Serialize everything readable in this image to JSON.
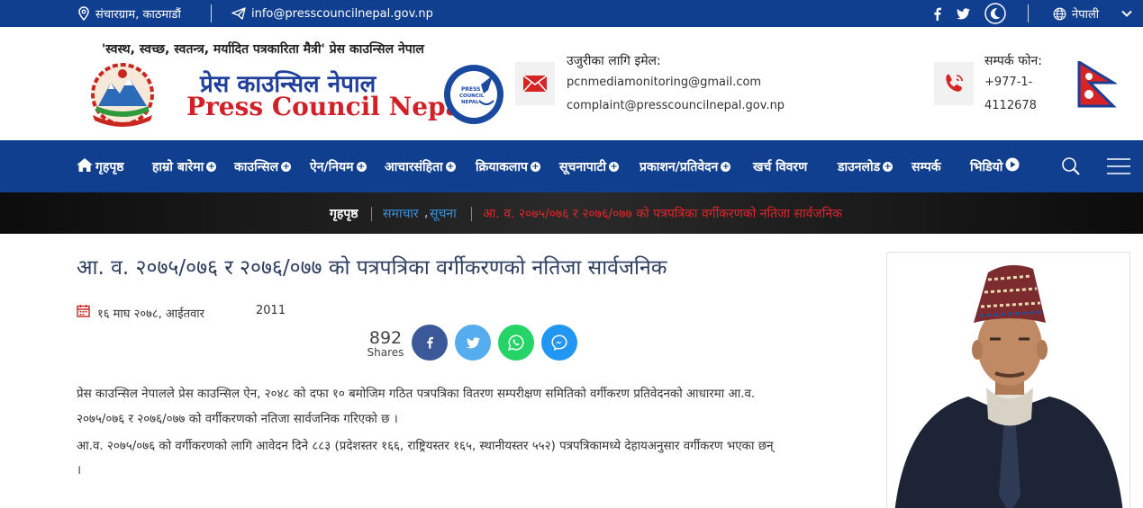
{
  "topbar": {
    "location": "संचारग्राम, काठमाडौं",
    "email": "info@presscouncilnepal.gov.np",
    "language": "नेपाली",
    "icons": [
      "location-icon",
      "send-icon",
      "facebook-icon",
      "twitter-icon",
      "moon-icon",
      "globe-icon",
      "chevron-down-icon"
    ]
  },
  "header": {
    "tagline": "'स्वस्थ, स्वच्छ, स्वतन्त्र, मर्यादित पत्रकारिता मैत्री' प्रेस काउन्सिल नेपाल",
    "logo_nepali": "प्रेस काउन्सिल नेपाल",
    "logo_english": "Press Council Nepal",
    "complaint_title": "उजुरीका लागि इमेल:",
    "complaint_email_1": "pcnmediamonitoring@gmail.com",
    "complaint_email_2": "complaint@presscouncilnepal.gov.np",
    "phone_title": "सम्पर्क फोन:",
    "phone_line_1": "+977-1-",
    "phone_line_2": "4112678"
  },
  "nav": {
    "items": [
      {
        "label": "गृहपृष्ठ"
      },
      {
        "label": "हाम्रो बारेमा"
      },
      {
        "label": "काउन्सिल"
      },
      {
        "label": "ऐन/नियम"
      },
      {
        "label": "आचारसंहिता"
      },
      {
        "label": "क्रियाकलाप"
      },
      {
        "label": "सूचनापाटी"
      },
      {
        "label": "प्रकाशन/प्रतिवेदन"
      },
      {
        "label": "खर्च विवरण"
      },
      {
        "label": "डाउनलोड"
      },
      {
        "label": "सम्पर्क"
      },
      {
        "label": "भिडियो"
      }
    ]
  },
  "breadcrumb": {
    "home": "गृहपृष्ठ",
    "category_1": "समाचार",
    "comma": ",",
    "category_2": "सूचना",
    "current": "आ. व. २०७५/०७६ र २०७६/०७७ को पत्रपत्रिका वर्गीकरणको नतिजा सार्वजनिक"
  },
  "article": {
    "title": "आ. व. २०७५/०७६ र २०७६/०७७ को पत्रपत्रिका वर्गीकरणको नतिजा सार्वजनिक",
    "date": "१६ माघ २०७८, आईतवार",
    "views": "2011",
    "shares_count": "892",
    "shares_label": "Shares",
    "para_1_line_1": "प्रेस काउन्सिल नेपालले प्रेस काउन्सिल ऐन, २०४८ को दफा १० बमोजिम गठित पत्रपत्रिका वितरण सम्परीक्षण समितिको वर्गीकरण प्रतिवेदनको आधारमा आ.व.",
    "para_1_line_2": "२०७५/०७६ र २०७६/०७७ को वर्गीकरणको नतिजा सार्वजनिक गरिएको छ ।",
    "para_2_line_1": "आ.व. २०७५/०७६ को वर्गीकरणको लागि आवेदन दिने ८८३ (प्रदेशस्तर १६६, राष्ट्रियस्तर १६५, स्थानीयस्तर ५५२) पत्रपत्रिकामध्ये देहायअनुसार वर्गीकरण भएका छन्",
    "para_2_line_2": "।"
  },
  "colors": {
    "brand_blue": "#0f3f8e",
    "breadcrumb_link": "#3b8fd9",
    "breadcrumb_current": "#e0262b",
    "facebook": "#3b5998",
    "twitter": "#55acee",
    "whatsapp": "#25d366",
    "messenger": "#2196f3"
  }
}
